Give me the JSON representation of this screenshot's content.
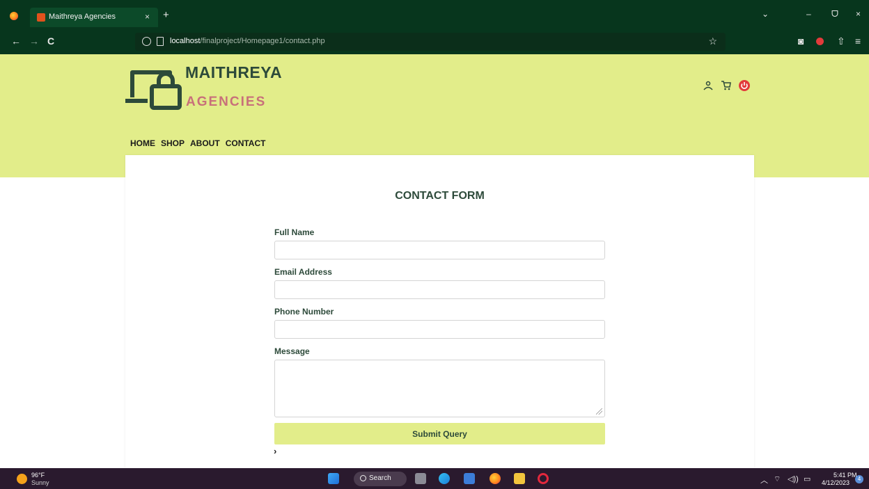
{
  "browser": {
    "tab_title": "Maithreya Agencies",
    "tab_close": "×",
    "new_tab": "+",
    "url_host": "localhost",
    "url_path": "/finalproject/Homepage1/contact.php",
    "nav_back": "←",
    "nav_forward": "→",
    "nav_reload": "C",
    "list_tabs": "⌄",
    "minimize": "–",
    "restore": "ᗜ",
    "close": "×",
    "bookmark_star": "☆",
    "pocket": "◙",
    "extensions": "⇧",
    "menu": "≡"
  },
  "site": {
    "brand_line1": "MAITHREYA",
    "brand_line2": "AGENCIES",
    "brand_color": "#e2ed8a",
    "accent_text_color": "#c8707a",
    "nav": [
      "HOME",
      "SHOP",
      "ABOUT",
      "CONTACT"
    ],
    "header_icons": [
      "user-icon",
      "cart-icon",
      "power-icon"
    ]
  },
  "form": {
    "title": "CONTACT FORM",
    "full_name_label": "Full Name",
    "full_name_value": "",
    "email_label": "Email Address",
    "email_value": "",
    "phone_label": "Phone Number",
    "phone_value": "",
    "message_label": "Message",
    "message_value": "",
    "submit_label": "Submit Query",
    "chevron": "›"
  },
  "taskbar": {
    "weather_temp": "96°F",
    "weather_desc": "Sunny",
    "search_label": "Search",
    "time": "5:41 PM",
    "date": "4/12/2023",
    "notification_count": "4",
    "tray_chevron": "︿",
    "tray_wifi": "⌔",
    "tray_volume": "◁))",
    "tray_battery": "▭"
  }
}
